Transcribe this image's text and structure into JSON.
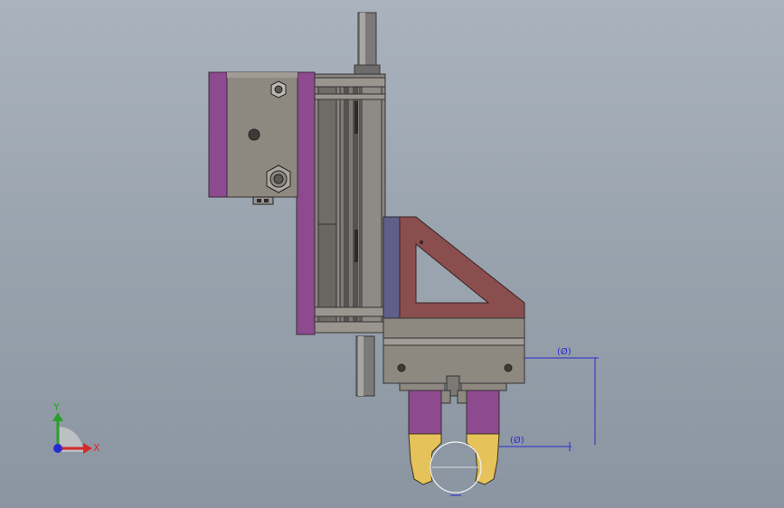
{
  "viewport": {
    "background_top": "#aab3bd",
    "background_bottom": "#8a95a1"
  },
  "parts": {
    "cylinder_block_color": "#8d8880",
    "plate_color_purple": "#8e4a8e",
    "bracket_color": "#8b4e4e",
    "adapter_plate_color": "#5f5f8a",
    "finger_color": "#8e4a8e",
    "jaw_color": "#e6c25a"
  },
  "dimensions": {
    "color": "#2a2ad0",
    "vertical_label": "(Ø)",
    "horizontal_label": "(Ø)"
  },
  "triad": {
    "x_label": "X",
    "y_label": "Y",
    "x_color": "#d42a2a",
    "y_color": "#2aa02a",
    "z_color": "#2a2ad4"
  }
}
